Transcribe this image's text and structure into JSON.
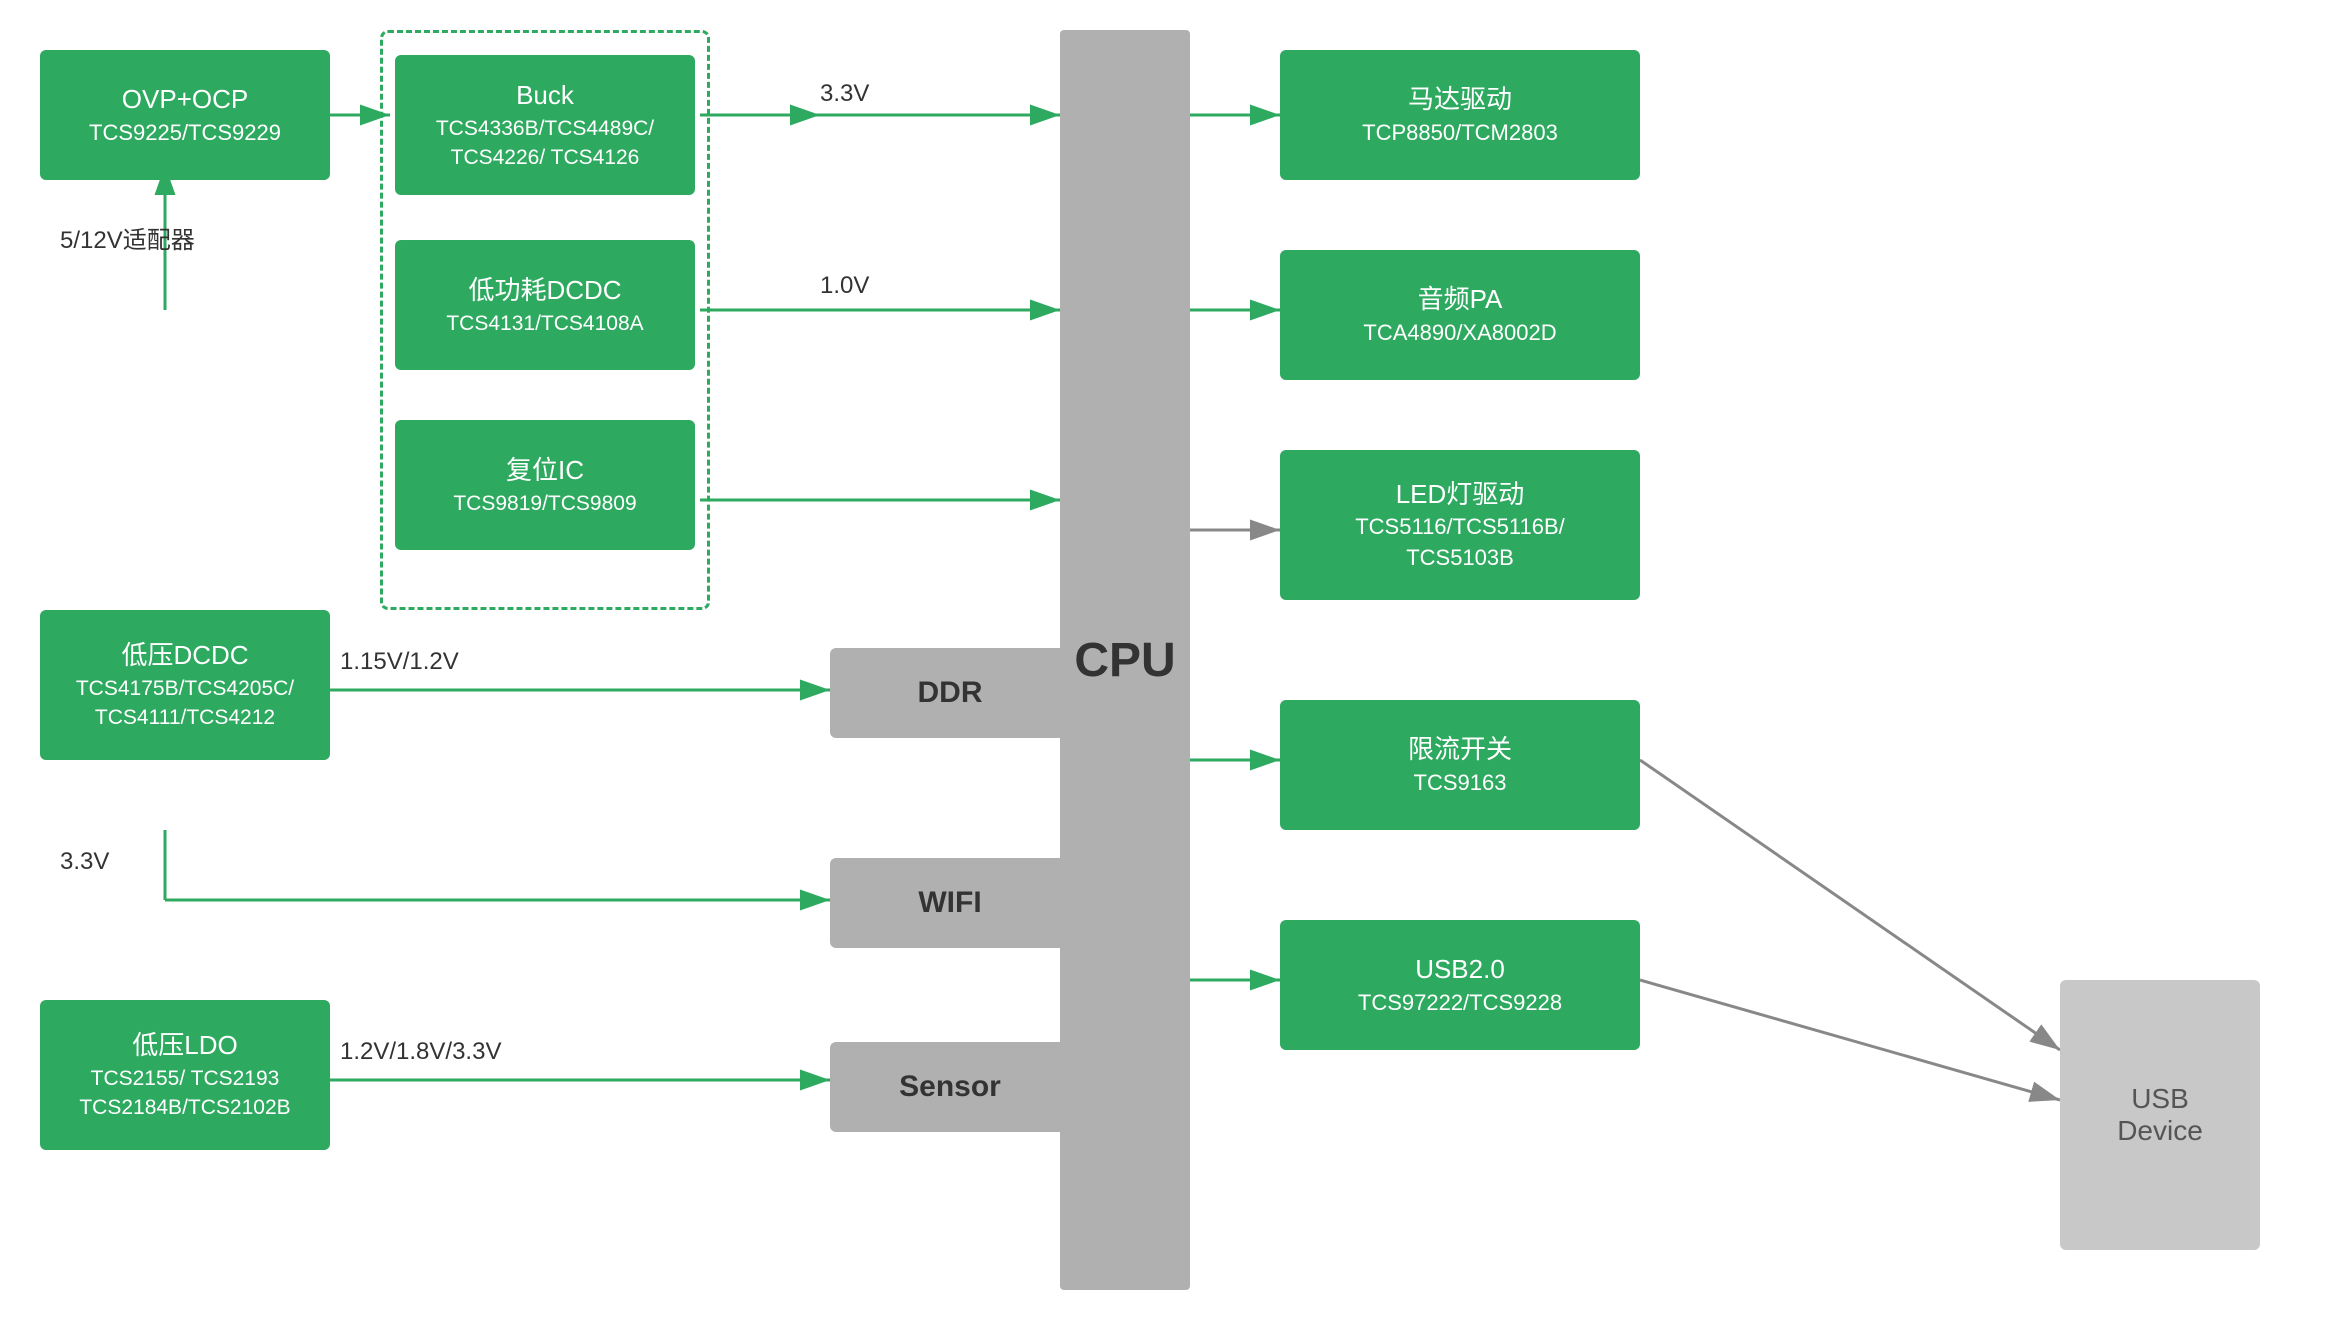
{
  "boxes": {
    "ovp_ocp": {
      "label_line1": "OVP+OCP",
      "label_line2": "TCS9225/TCS9229"
    },
    "buck": {
      "label_line1": "Buck",
      "label_line2": "TCS4336B/TCS4489C/",
      "label_line3": "TCS4226/ TCS4126"
    },
    "low_power_dcdc": {
      "label_line1": "低功耗DCDC",
      "label_line2": "TCS4131/TCS4108A"
    },
    "reset_ic": {
      "label_line1": "复位IC",
      "label_line2": "TCS9819/TCS9809"
    },
    "low_voltage_dcdc": {
      "label_line1": "低压DCDC",
      "label_line2": "TCS4175B/TCS4205C/",
      "label_line3": "TCS4111/TCS4212"
    },
    "low_voltage_ldo": {
      "label_line1": "低压LDO",
      "label_line2": "TCS2155/ TCS2193",
      "label_line3": "TCS2184B/TCS2102B"
    },
    "ddr": {
      "label": "DDR"
    },
    "wifi": {
      "label": "WIFI"
    },
    "sensor": {
      "label": "Sensor"
    },
    "cpu": {
      "label": "CPU"
    },
    "motor_driver": {
      "label_line1": "马达驱动",
      "label_line2": "TCP8850/TCM2803"
    },
    "audio_pa": {
      "label_line1": "音频PA",
      "label_line2": "TCA4890/XA8002D"
    },
    "led_driver": {
      "label_line1": "LED灯驱动",
      "label_line2": "TCS5116/TCS5116B/",
      "label_line3": "TCS5103B"
    },
    "current_limit": {
      "label_line1": "限流开关",
      "label_line2": "TCS9163"
    },
    "usb2": {
      "label_line1": "USB2.0",
      "label_line2": "TCS97222/TCS9228"
    },
    "usb_device": {
      "label_line1": "USB",
      "label_line2": "Device"
    }
  },
  "arrow_labels": {
    "adapter": "5/12V适配器",
    "v33_top": "3.3V",
    "v10": "1.0V",
    "v115_12": "1.15V/1.2V",
    "v33_mid": "3.3V",
    "v12_18_33": "1.2V/1.8V/3.3V"
  },
  "colors": {
    "green": "#2eaa60",
    "gray": "#b0b0b0",
    "dark_gray": "#888888",
    "white": "#ffffff",
    "text_dark": "#333333"
  }
}
